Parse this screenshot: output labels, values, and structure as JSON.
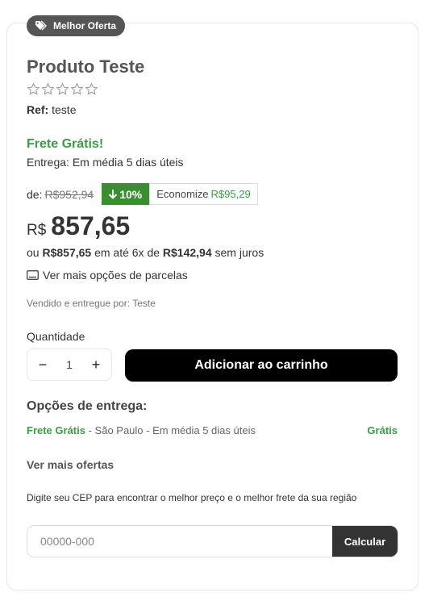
{
  "badge": {
    "label": "Melhor Oferta",
    "icon": "tag-icon"
  },
  "product": {
    "title": "Produto Teste",
    "rating": 0,
    "ref_label": "Ref:",
    "ref_value": "teste"
  },
  "shipping": {
    "headline": "Frete Grátis!",
    "delivery": "Entrega: Em média 5 dias úteis"
  },
  "pricing": {
    "from_label": "de:",
    "old_price": "R$952,94",
    "discount": "10%",
    "economize_label": "Economize",
    "economize_value": "R$95,29",
    "currency": "R$",
    "price": "857,65",
    "installment_prefix": "ou",
    "installment_total": "R$857,65",
    "installment_mid": "em até 6x de",
    "installment_value": "R$142,94",
    "installment_suffix": "sem juros",
    "more_installments": "Ver mais opções de parcelas"
  },
  "seller": "Vendido e entregue por: Teste",
  "quantity": {
    "label": "Quantidade",
    "value": "1",
    "minus": "−",
    "plus": "+"
  },
  "cart_button": "Adicionar ao carrinho",
  "delivery_options": {
    "title": "Opções de entrega:",
    "option_name": "Frete Grátis",
    "option_detail": " - São Paulo - Em média 5 dias úteis",
    "option_price": "Grátis"
  },
  "more_offers": "Ver mais ofertas",
  "cep": {
    "description": "Digite seu CEP para encontrar o melhor preço e o melhor frete da sua região",
    "placeholder": "00000-000",
    "button": "Calcular"
  },
  "colors": {
    "green": "#3d9b46",
    "discount_bg": "#3b8e2f",
    "badge_bg": "#555555"
  }
}
